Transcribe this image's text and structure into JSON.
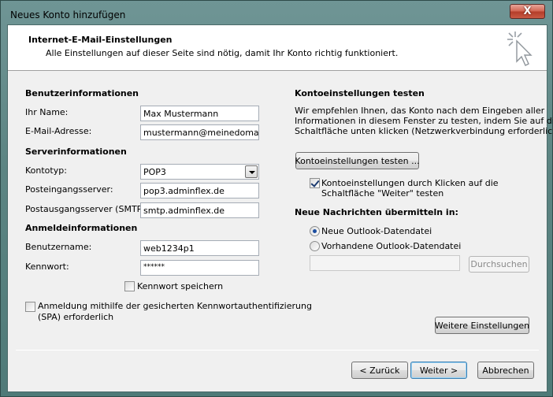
{
  "window": {
    "title": "Neues Konto hinzufügen",
    "close_label": "X"
  },
  "header": {
    "title": "Internet-E-Mail-Einstellungen",
    "subtitle": "Alle Einstellungen auf dieser Seite sind nötig, damit Ihr Konto richtig funktioniert."
  },
  "user_info": {
    "section": "Benutzerinformationen",
    "name_label": "Ihr Name:",
    "name_value": "Max Mustermann",
    "email_label": "E-Mail-Adresse:",
    "email_value": "mustermann@meinedomain.de"
  },
  "server_info": {
    "section": "Serverinformationen",
    "account_type_label": "Kontotyp:",
    "account_type_value": "POP3",
    "incoming_label": "Posteingangsserver:",
    "incoming_value": "pop3.adminflex.de",
    "outgoing_label": "Postausgangsserver (SMTP):",
    "outgoing_value": "smtp.adminflex.de"
  },
  "login_info": {
    "section": "Anmeldeinformationen",
    "username_label": "Benutzername:",
    "username_value": "web1234p1",
    "password_label": "Kennwort:",
    "password_value": "******",
    "save_password_label": "Kennwort speichern",
    "save_password_checked": false,
    "spa_label_line1": "Anmeldung mithilfe der gesicherten Kennwortauthentifizierung",
    "spa_label_line2": "(SPA) erforderlich",
    "spa_checked": false
  },
  "test_settings": {
    "section": "Kontoeinstellungen testen",
    "desc_line1": "Wir empfehlen Ihnen, das Konto nach dem Eingeben aller",
    "desc_line2": "Informationen in diesem Fenster zu testen, indem Sie auf die",
    "desc_line3": "Schaltfläche unten klicken (Netzwerkverbindung erforderlich).",
    "test_button": "Kontoeinstellungen testen ...",
    "auto_test_line1": "Kontoeinstellungen durch Klicken auf die",
    "auto_test_line2": "Schaltfläche \"Weiter\" testen",
    "auto_test_checked": true
  },
  "deliver": {
    "section": "Neue Nachrichten übermitteln in:",
    "option_new": "Neue Outlook-Datendatei",
    "option_existing": "Vorhandene Outlook-Datendatei",
    "selected": "new",
    "path_value": "",
    "browse_button": "Durchsuchen"
  },
  "more_settings_button": "Weitere Einstellungen",
  "footer": {
    "back": "< Zurück",
    "next": "Weiter >",
    "cancel": "Abbrechen"
  }
}
